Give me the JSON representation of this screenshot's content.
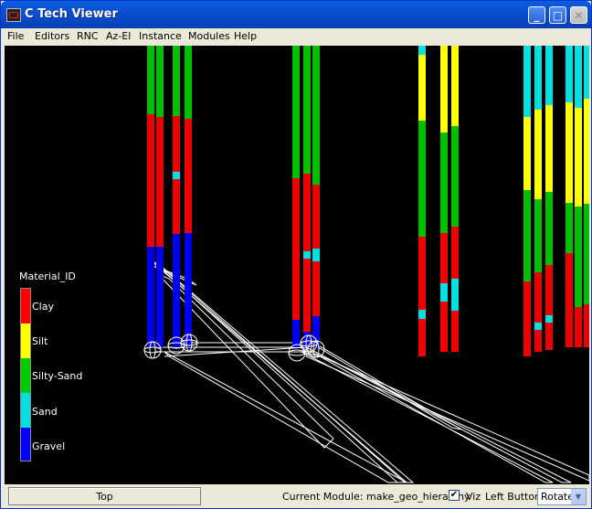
{
  "window": {
    "title": "C Tech Viewer"
  },
  "menu": [
    "File",
    "Editors",
    "RNC",
    "Az-El",
    "Instance",
    "Modules",
    "Help"
  ],
  "legend": {
    "title": "Material_ID",
    "items": [
      {
        "label": "Clay",
        "color": "#ff0000"
      },
      {
        "label": "Silt",
        "color": "#ffff00"
      },
      {
        "label": "Silty-Sand",
        "color": "#00cc00"
      },
      {
        "label": "Sand",
        "color": "#00e0e0"
      },
      {
        "label": "Gravel",
        "color": "#0000ff"
      }
    ]
  },
  "status": {
    "top_button": "Top",
    "current_module": "Current Module: make_geo_hierarchy",
    "viz_checked": true,
    "viz_label": "Viz",
    "left_button_label": "Left Button",
    "mode_value": "Rotate"
  }
}
